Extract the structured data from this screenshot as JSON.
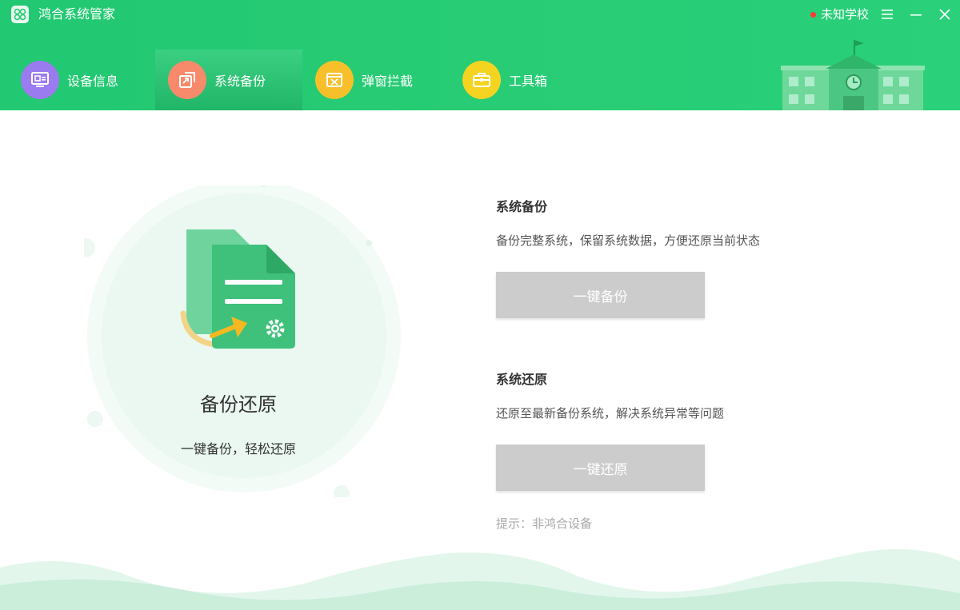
{
  "app": {
    "title": "鸿合系统管家"
  },
  "titlebar": {
    "school_name": "未知学校"
  },
  "nav": {
    "tabs": [
      {
        "label": "设备信息",
        "icon": "monitor-icon",
        "color": "#9b7bf0"
      },
      {
        "label": "系统备份",
        "icon": "backup-icon",
        "color": "#f88a6c"
      },
      {
        "label": "弹窗拦截",
        "icon": "popup-block-icon",
        "color": "#f7c02b"
      },
      {
        "label": "工具箱",
        "icon": "toolbox-icon",
        "color": "#f4d321"
      }
    ],
    "active_index": 1
  },
  "hero": {
    "title": "备份还原",
    "subtitle": "一键备份，轻松还原"
  },
  "backup": {
    "title": "系统备份",
    "description": "备份完整系统，保留系统数据，方便还原当前状态",
    "button_label": "一键备份"
  },
  "restore": {
    "title": "系统还原",
    "description": "还原至最新备份系统，解决系统异常等问题",
    "button_label": "一键还原"
  },
  "tip": "提示：非鸿合设备",
  "colors": {
    "header_green": "#27cc74",
    "button_disabled": "#cccccc",
    "alert_dot": "#ff3b30"
  }
}
